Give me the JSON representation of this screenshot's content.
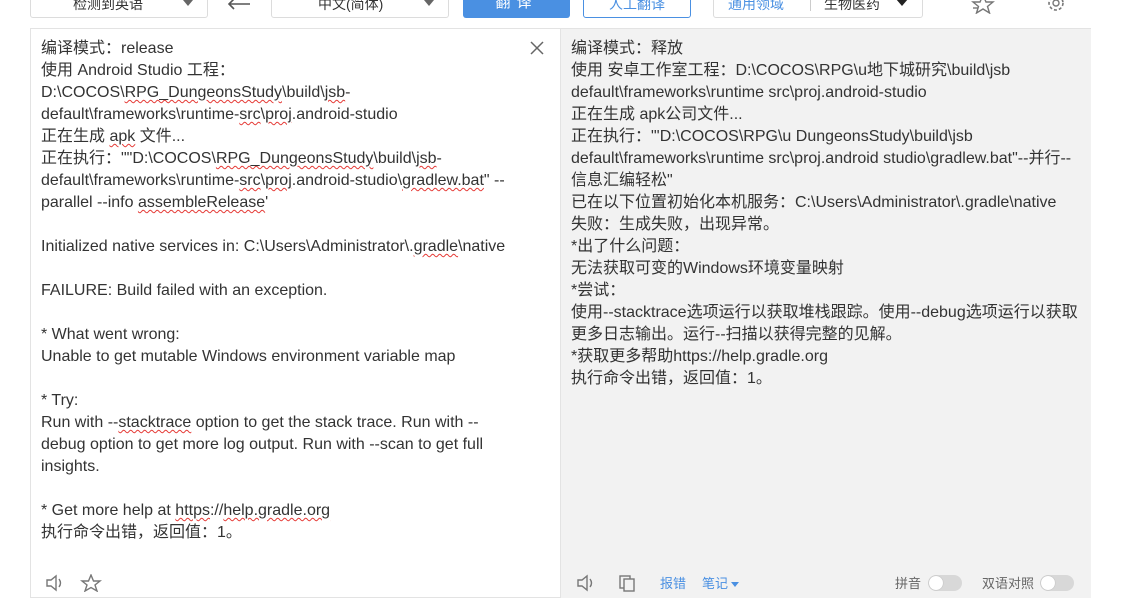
{
  "toolbar": {
    "source_lang": "检测到英语",
    "target_lang": "中文(简体)",
    "translate_button": "翻译",
    "human_translate_button": "人工翻译",
    "domain_label": "通用领域",
    "domain_value": "生物医药"
  },
  "source": {
    "lines": [
      "编译模式：release",
      "使用 Android Studio 工程：",
      "D:\\COCOS\\RPG_DungeonsStudy\\build\\jsb-",
      "default\\frameworks\\runtime-src\\proj.android-studio",
      "正在生成 apk 文件...",
      "正在执行：\"\"D:\\COCOS\\RPG_DungeonsStudy\\build\\jsb-",
      "default\\frameworks\\runtime-src\\proj.android-studio\\gradlew.bat\" --",
      "parallel --info assembleRelease'",
      "",
      "Initialized native services in: C:\\Users\\Administrator\\.gradle\\native",
      "",
      "FAILURE: Build failed with an exception.",
      "",
      "* What went wrong:",
      "Unable to get mutable Windows environment variable map",
      "",
      "* Try:",
      "Run with --stacktrace option to get the stack trace. Run with --",
      "debug option to get more log output. Run with --scan to get full",
      "insights.",
      "",
      "* Get more help at https://help.gradle.org",
      "执行命令出错，返回值：1。"
    ]
  },
  "target": {
    "lines": [
      "编译模式：释放",
      "使用 安卓工作室工程：D:\\COCOS\\RPG\\u地下城研究\\build\\jsb",
      "default\\frameworks\\runtime src\\proj.android-studio",
      "正在生成 apk公司文件...",
      "正在执行：\"'D:\\COCOS\\RPG\\u DungeonsStudy\\build\\jsb",
      "default\\frameworks\\runtime src\\proj.android studio\\gradlew.bat\"--并行--",
      "信息汇编轻松\"",
      "已在以下位置初始化本机服务：C:\\Users\\Administrator\\.gradle\\native",
      "失败：生成失败，出现异常。",
      "*出了什么问题：",
      "无法获取可变的Windows环境变量映射",
      "*尝试：",
      "使用--stacktrace选项运行以获取堆栈跟踪。使用--debug选项运行以获取",
      "更多日志输出。运行--扫描以获得完整的见解。",
      "*获取更多帮助https://help.gradle.org",
      "执行命令出错，返回值：1。"
    ]
  },
  "bottom": {
    "report_link": "报错",
    "note_link": "笔记",
    "pinyin_label": "拼音",
    "bilingual_label": "双语对照"
  },
  "colors": {
    "accent": "#4a90e2",
    "spell_underline": "#e53935",
    "result_bg": "#f2f2f2"
  }
}
